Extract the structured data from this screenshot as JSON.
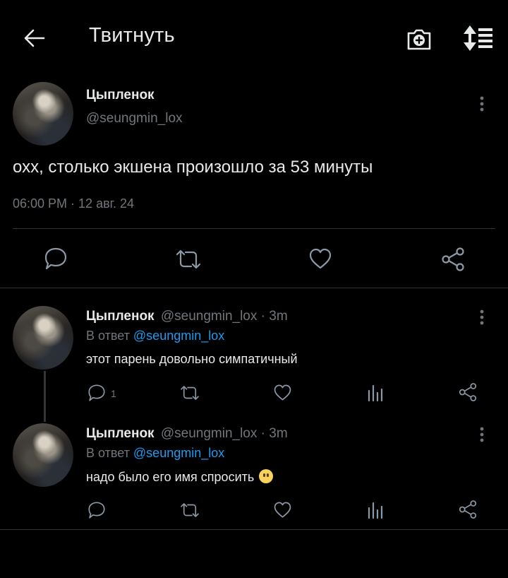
{
  "header": {
    "title": "Твитнуть"
  },
  "tweet": {
    "author_name": "Цыпленок",
    "author_handle": "@seungmin_lox",
    "text": "охх, столько экшена произошло за 53 минуты",
    "timestamp": "06:00 PM · 12 авг. 24"
  },
  "replies": [
    {
      "author_name": "Цыпленок",
      "author_meta": "@seungmin_lox · 3m",
      "reply_prefix": "В ответ",
      "reply_mention": "@seungmin_lox",
      "text": "этот парень довольно симпатичный",
      "reply_count": "1"
    },
    {
      "author_name": "Цыпленок",
      "author_meta": "@seungmin_lox · 3m",
      "reply_prefix": "В ответ",
      "reply_mention": "@seungmin_lox",
      "text": "надо было его имя спросить",
      "emoji": "face-without-mouth"
    }
  ]
}
